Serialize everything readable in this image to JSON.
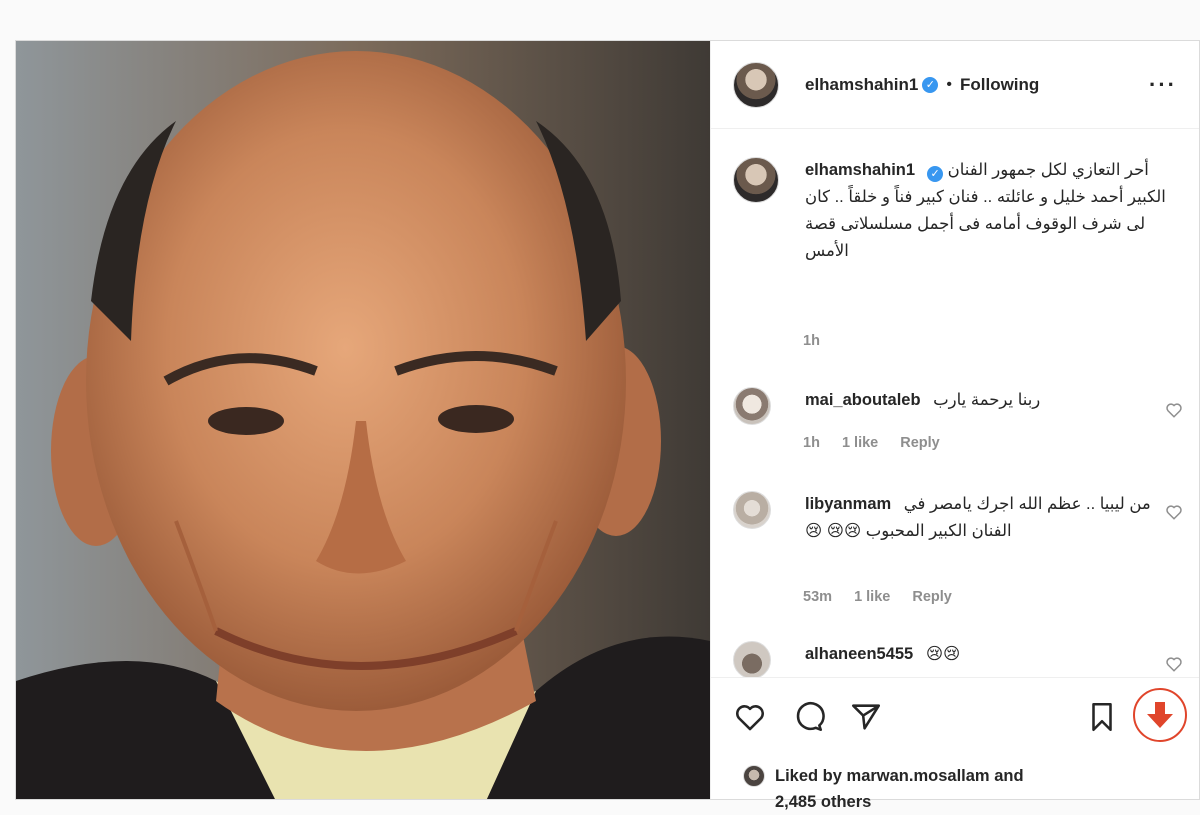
{
  "post": {
    "author": "elhamshahin1",
    "follow_state": "Following",
    "caption": "أحر التعازي لكل جمهور الفنان الكبير أحمد خليل و عائلته .. فنان كبير فناً و خلقاً .. كان لى شرف الوقوف أمامه فى أجمل مسلسلاتى قصة الأمس",
    "caption_time": "1h"
  },
  "comments": [
    {
      "user": "mai_aboutaleb",
      "text": "ربنا يرحمة يارب",
      "time": "1h",
      "likes": "1 like",
      "reply": "Reply"
    },
    {
      "user": "libyanmam",
      "text": "من ليبيا .. عظم الله اجرك يامصر في الفنان الكبير المحبوب 😢😢 😢",
      "time": "53m",
      "likes": "1 like",
      "reply": "Reply"
    },
    {
      "user": "alhaneen5455",
      "text": "😢😢"
    }
  ],
  "likes_summary": {
    "prefix": "Liked by",
    "user": "marwan.mosallam",
    "middle": "and",
    "others": "2,485 others"
  },
  "icons": {
    "verified": "verified-badge-icon",
    "more": "more-options-icon",
    "like": "heart-icon",
    "comment": "comment-icon",
    "share": "paper-plane-icon",
    "save": "bookmark-icon",
    "download": "download-arrow-icon"
  },
  "colors": {
    "verified_blue": "#3897f0",
    "download_red": "#e0452b",
    "muted_text": "#8e8e8e"
  }
}
